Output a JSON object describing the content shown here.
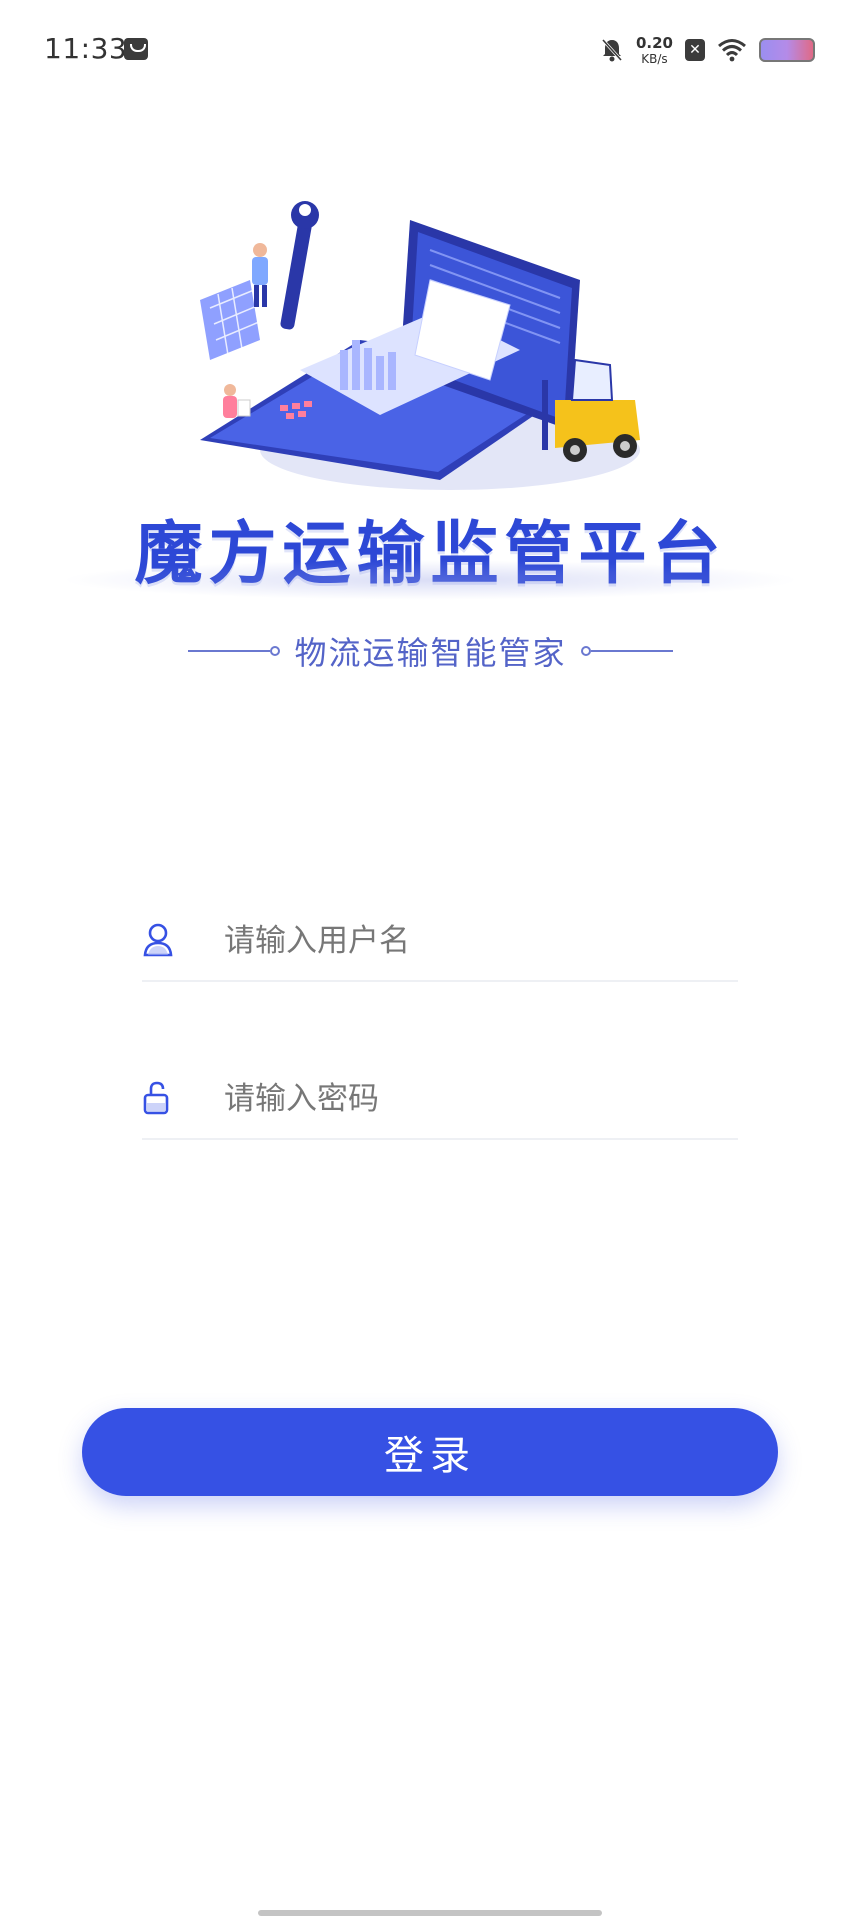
{
  "status_bar": {
    "time": "11:33",
    "speed_value": "0.20",
    "speed_unit": "KB/s",
    "sim_icon_glyph": "✕"
  },
  "header": {
    "title": "魔方运输监管平台",
    "subtitle": "物流运输智能管家"
  },
  "form": {
    "username_placeholder": "请输入用户名",
    "username_value": "",
    "password_placeholder": "请输入密码",
    "password_value": ""
  },
  "actions": {
    "login_label": "登录"
  },
  "colors": {
    "primary": "#3651e4",
    "title": "#2d48d6",
    "subtitle": "#5464c8"
  },
  "icons": {
    "user": "user-icon",
    "lock": "lock-icon"
  }
}
